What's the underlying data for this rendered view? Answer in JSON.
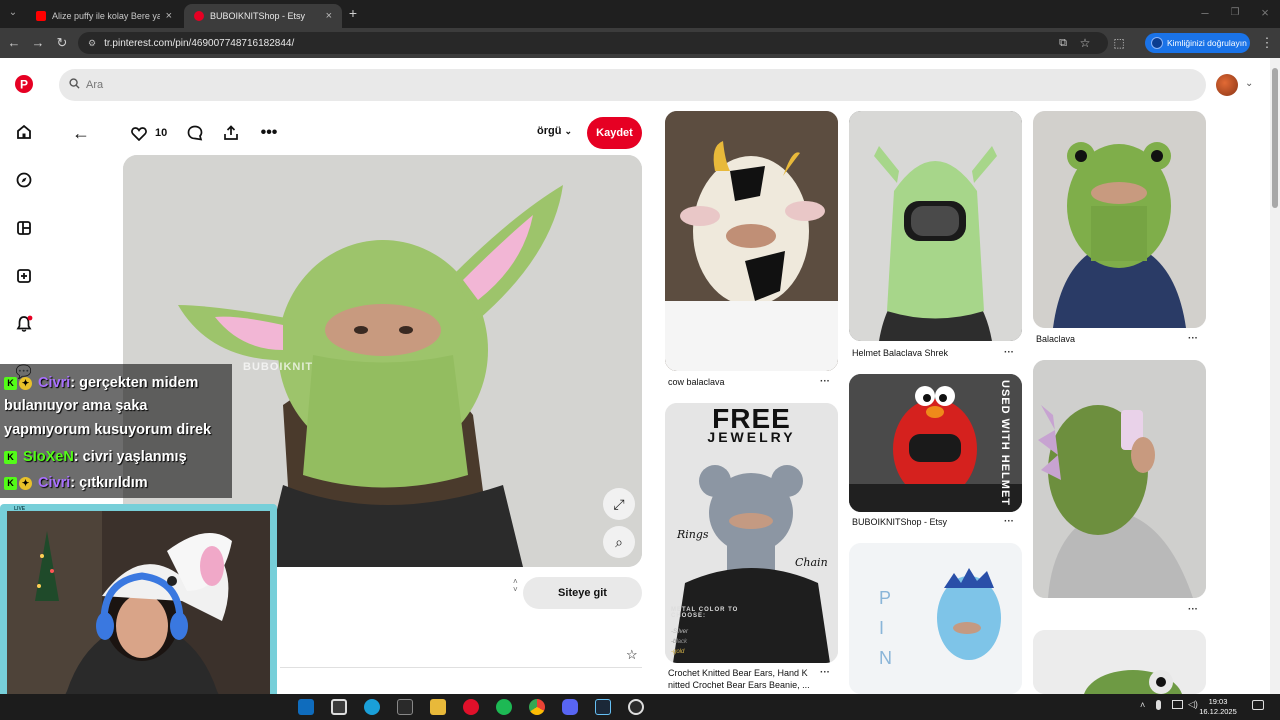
{
  "browser": {
    "tabs": [
      {
        "title": "Alize puffy ile kolay Bere yapımı",
        "favicon": "youtube-icon",
        "color": "#ff0000",
        "active": false
      },
      {
        "title": "BUBOIKNITShop - Etsy",
        "favicon": "pinterest-icon",
        "color": "#e60023",
        "active": true
      }
    ],
    "url": "tr.pinterest.com/pin/469007748716182844/",
    "identity_label": "Kimliğinizi doğrulayın"
  },
  "pinterest": {
    "search_placeholder": "Ara",
    "pin": {
      "like_count": "10",
      "board_label": "örgü",
      "save_label": "Kaydet",
      "watermark": "BUBOIKNIT",
      "visit_label": "Siteye git"
    },
    "grid": [
      {
        "caption": "cow balaclava"
      },
      {
        "caption": "Helmet Balaclava Shrek"
      },
      {
        "caption": "Balaclava"
      },
      {
        "caption": "Crochet Knitted Bear Ears, Hand K",
        "caption2": "nitted Crochet Bear Ears Beanie, ...",
        "overlay_title": "FREE",
        "overlay_sub": "JEWELRY",
        "overlay_rings": "Rings",
        "overlay_chain": "Chain",
        "overlay_metal": "METAL COLOR TO CHOOSE:",
        "overlay_opts": [
          "-Silver",
          "-black",
          "-gold"
        ]
      },
      {
        "caption": "BUBOIKNITShop - Etsy",
        "overlay_text": "USED WITH HELMET"
      },
      {
        "caption": ""
      },
      {
        "caption": "",
        "overlay_text": "PIN"
      }
    ]
  },
  "stream": {
    "chat": [
      {
        "user": "Civri",
        "message": ": gerçekten midem",
        "user_color": "#a970ff"
      },
      {
        "user": "",
        "message": "bulanıuyor ama şaka",
        "user_color": ""
      },
      {
        "user": "",
        "message": "yapmıyorum kusuyorum direk",
        "user_color": ""
      },
      {
        "user": "SIoXeN",
        "message": ": civri yaşlanmış",
        "user_color": "#53fc18"
      },
      {
        "user": "Civri",
        "message": ": çıtkırıldım",
        "user_color": "#a970ff"
      }
    ],
    "webcam_label": "LIVE"
  },
  "taskbar": {
    "time": "19:03",
    "date": "16.12.2025"
  }
}
